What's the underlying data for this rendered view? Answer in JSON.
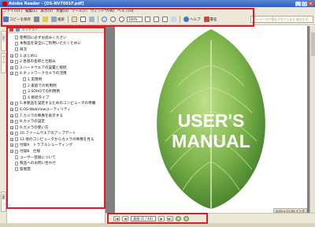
{
  "window": {
    "title": "Adobe Reader - [DS-NV7001F.pdf]",
    "min": "_",
    "max": "□",
    "close": "×"
  },
  "menu": [
    "ファイル(F)",
    "編集(E)",
    "表示(V)",
    "文書(D)",
    "ツール(T)",
    "ウィンドウ(W)",
    "ヘルプ(H)"
  ],
  "toolbar": {
    "save_label": "コピーを保存",
    "print_label": "",
    "search_label": "検索",
    "zoom_value": "100%",
    "help_label": "ヘルプ",
    "sign_label": "署名"
  },
  "search": {
    "placeholder": "→ データが保存されています 保存する..."
  },
  "sidebar": {
    "tabs": [
      "しおり",
      "ページ",
      "注釈"
    ],
    "header_label": "オプション",
    "items": [
      {
        "label": "使用前に必ずお読みください",
        "expandable": false,
        "level": 0
      },
      {
        "label": "本製品を安全にご利用いただくために",
        "expandable": false,
        "level": 0
      },
      {
        "label": "目次",
        "expandable": false,
        "level": 0
      },
      {
        "label": "1.はじめに",
        "expandable": true,
        "level": 0
      },
      {
        "label": "2.各部の名称と仕組み",
        "expandable": true,
        "level": 0
      },
      {
        "label": "3.ハードウエアの設置と接続",
        "expandable": true,
        "level": 0
      },
      {
        "label": "4.ネットワークカメラの活用",
        "expandable": true,
        "level": 0
      },
      {
        "label": "1.実用例",
        "expandable": false,
        "level": 1
      },
      {
        "label": "2.家庭での利用例",
        "expandable": false,
        "level": 1
      },
      {
        "label": "3.SOHOでの利用例",
        "expandable": false,
        "level": 1
      },
      {
        "label": "4.接続タイプ",
        "expandable": false,
        "level": 1
      },
      {
        "label": "5.本製品を設定するためのコンピュータの準備",
        "expandable": true,
        "level": 0
      },
      {
        "label": "6.OS-WebViewユーティリティ",
        "expandable": true,
        "level": 0
      },
      {
        "label": "7.カメラの映像を表示する",
        "expandable": true,
        "level": 0
      },
      {
        "label": "8.カメラの設定",
        "expandable": true,
        "level": 0
      },
      {
        "label": "9.カメラの使い方",
        "expandable": true,
        "level": 0
      },
      {
        "label": "10.ファームウエアのアップデート",
        "expandable": true,
        "level": 0
      },
      {
        "label": "11.他のコンピュータからカメラの映像を見る",
        "expandable": true,
        "level": 0
      },
      {
        "label": "付録A　トラブルシューティング",
        "expandable": true,
        "level": 0
      },
      {
        "label": "付録B　仕様",
        "expandable": true,
        "level": 0
      },
      {
        "label": "ユーザー登録について",
        "expandable": false,
        "level": 0
      },
      {
        "label": "製品へのお問い合わせ",
        "expandable": false,
        "level": 0
      },
      {
        "label": "質問票",
        "expandable": false,
        "level": 0
      }
    ]
  },
  "document": {
    "cover_line1": "USER'S",
    "cover_line2": "MANUAL"
  },
  "status": {
    "page_field": "表紙 (1 / 44)",
    "page_size": "8.50 x 11.00 インチ",
    "first": "|◀",
    "prev": "◀",
    "next": "▶",
    "last": "▶|"
  },
  "colors": {
    "highlight": "#d61f2a",
    "leaf_light": "#8fc25a",
    "leaf_dark": "#3f7a2a"
  }
}
